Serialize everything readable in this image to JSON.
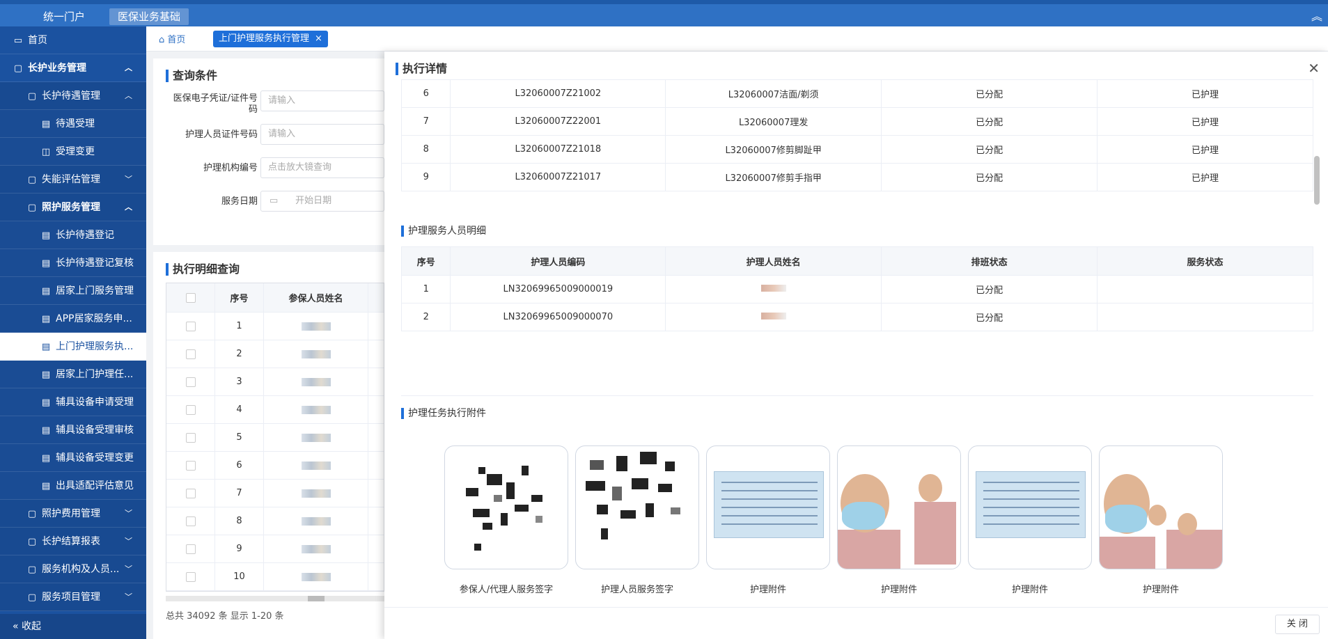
{
  "topbar": {
    "system1": "统一门户",
    "system2": "医保业务基础",
    "collapse_icon": "chevron-up-icon"
  },
  "sidebar": {
    "items": [
      {
        "label": "首页",
        "level": 0,
        "icon": "monitor-icon",
        "bold": false
      },
      {
        "label": "长护业务管理",
        "level": 0,
        "icon": "folder-icon",
        "bold": true,
        "arrow": "︿"
      },
      {
        "label": "长护待遇管理",
        "level": 1,
        "icon": "folder-icon",
        "bold": false,
        "arrow": "︿"
      },
      {
        "label": "待遇受理",
        "level": 2,
        "icon": "doc-icon",
        "bold": false
      },
      {
        "label": "受理变更",
        "level": 2,
        "icon": "book-icon",
        "bold": false
      },
      {
        "label": "失能评估管理",
        "level": 1,
        "icon": "folder-icon",
        "bold": false,
        "arrow": "﹀"
      },
      {
        "label": "照护服务管理",
        "level": 1,
        "icon": "folder-icon",
        "bold": true,
        "arrow": "︿"
      },
      {
        "label": "长护待遇登记",
        "level": 2,
        "icon": "doc-icon",
        "bold": false
      },
      {
        "label": "长护待遇登记复核",
        "level": 2,
        "icon": "doc-icon",
        "bold": false
      },
      {
        "label": "居家上门服务管理",
        "level": 2,
        "icon": "doc-icon",
        "bold": false
      },
      {
        "label": "APP居家服务申...",
        "level": 2,
        "icon": "doc-icon",
        "bold": false
      },
      {
        "label": "上门护理服务执...",
        "level": 2,
        "icon": "doc-icon",
        "bold": false,
        "active": true
      },
      {
        "label": "居家上门护理任...",
        "level": 2,
        "icon": "doc-icon",
        "bold": false
      },
      {
        "label": "辅具设备申请受理",
        "level": 2,
        "icon": "doc-icon",
        "bold": false
      },
      {
        "label": "辅具设备受理审核",
        "level": 2,
        "icon": "doc-icon",
        "bold": false
      },
      {
        "label": "辅具设备受理变更",
        "level": 2,
        "icon": "doc-icon",
        "bold": false
      },
      {
        "label": "出具适配评估意见",
        "level": 2,
        "icon": "doc-icon",
        "bold": false
      },
      {
        "label": "照护费用管理",
        "level": 1,
        "icon": "folder-icon",
        "bold": false,
        "arrow": "﹀"
      },
      {
        "label": "长护结算报表",
        "level": 1,
        "icon": "folder-icon",
        "bold": false,
        "arrow": "﹀"
      },
      {
        "label": "服务机构及人员...",
        "level": 1,
        "icon": "folder-icon",
        "bold": false,
        "arrow": "﹀"
      },
      {
        "label": "服务项目管理",
        "level": 1,
        "icon": "folder-icon",
        "bold": false,
        "arrow": "﹀"
      }
    ],
    "footer": "收起"
  },
  "tabs": {
    "home": "首页",
    "active": "上门护理服务执行管理",
    "close": "×"
  },
  "query": {
    "title": "查询条件",
    "fields": [
      {
        "label": "医保电子凭证/证件号码",
        "placeholder": "请输入"
      },
      {
        "label": "护理人员证件号码",
        "placeholder": "请输入"
      },
      {
        "label": "护理机构编号",
        "placeholder": "点击放大镜查询"
      },
      {
        "label": "服务日期",
        "placeholder": "开始日期"
      }
    ]
  },
  "detail_query": {
    "title": "执行明细查询",
    "headers": [
      "序号",
      "参保人员姓名"
    ],
    "rows": [
      "1",
      "2",
      "3",
      "4",
      "5",
      "6",
      "7",
      "8",
      "9",
      "10"
    ],
    "footer": "总共 34092 条 显示 1-20 条"
  },
  "drawer": {
    "title": "执行详情",
    "close_icon": "close-icon",
    "items": [
      {
        "no": "6",
        "code": "L32060007Z21002",
        "name": "L32060007洁面/剃须",
        "assign": "已分配",
        "status": "已护理"
      },
      {
        "no": "7",
        "code": "L32060007Z22001",
        "name": "L32060007理发",
        "assign": "已分配",
        "status": "已护理"
      },
      {
        "no": "8",
        "code": "L32060007Z21018",
        "name": "L32060007修剪脚趾甲",
        "assign": "已分配",
        "status": "已护理"
      },
      {
        "no": "9",
        "code": "L32060007Z21017",
        "name": "L32060007修剪手指甲",
        "assign": "已分配",
        "status": "已护理"
      }
    ],
    "staff_title": "护理服务人员明细",
    "staff_headers": [
      "序号",
      "护理人员编码",
      "护理人员姓名",
      "排班状态",
      "服务状态"
    ],
    "staff": [
      {
        "no": "1",
        "code": "LN32069965009000019",
        "assign": "已分配",
        "status": ""
      },
      {
        "no": "2",
        "code": "LN32069965009000070",
        "assign": "已分配",
        "status": ""
      }
    ],
    "attach_title": "护理任务执行附件",
    "attachments": [
      "参保人/代理人服务签字",
      "护理人员服务签字",
      "护理附件",
      "护理附件",
      "护理附件",
      "护理附件"
    ],
    "close_button": "关 闭"
  }
}
